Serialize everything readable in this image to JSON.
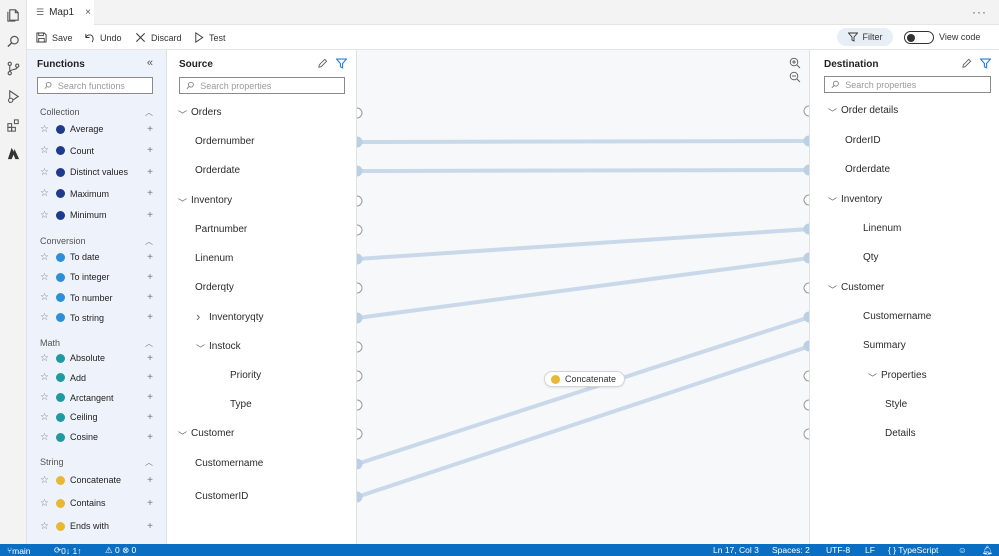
{
  "tab": {
    "title": "Map1",
    "close": "×"
  },
  "more": "···",
  "toolbar": {
    "save": "Save",
    "undo": "Undo",
    "discard": "Discard",
    "test": "Test",
    "filter": "Filter",
    "view_code": "View code",
    "view_code_enabled": false
  },
  "functions": {
    "title": "Functions",
    "search_placeholder": "Search functions",
    "categories": [
      {
        "name": "Collection",
        "items": [
          {
            "label": "Average",
            "color": "#1e3a8a"
          },
          {
            "label": "Count",
            "color": "#1e3a8a"
          },
          {
            "label": "Distinct values",
            "color": "#1e3a8a"
          },
          {
            "label": "Maximum",
            "color": "#1e3a8a"
          },
          {
            "label": "Minimum",
            "color": "#1e3a8a"
          }
        ]
      },
      {
        "name": "Conversion",
        "items": [
          {
            "label": "To date",
            "color": "#2b8fd9"
          },
          {
            "label": "To integer",
            "color": "#2b8fd9"
          },
          {
            "label": "To number",
            "color": "#2b8fd9"
          },
          {
            "label": "To string",
            "color": "#2b8fd9"
          }
        ]
      },
      {
        "name": "Math",
        "items": [
          {
            "label": "Absolute",
            "color": "#1e9aa0"
          },
          {
            "label": "Add",
            "color": "#1e9aa0"
          },
          {
            "label": "Arctangent",
            "color": "#1e9aa0"
          },
          {
            "label": "Ceiling",
            "color": "#1e9aa0"
          },
          {
            "label": "Cosine",
            "color": "#1e9aa0"
          }
        ]
      },
      {
        "name": "String",
        "items": [
          {
            "label": "Concatenate",
            "color": "#e8b733"
          },
          {
            "label": "Contains",
            "color": "#e8b733"
          },
          {
            "label": "Ends with",
            "color": "#e8b733"
          }
        ]
      }
    ]
  },
  "source": {
    "title": "Source",
    "search_placeholder": "Search properties",
    "nodes": [
      {
        "label": "Orders",
        "expander": "expanded"
      },
      {
        "label": "Ordernumber"
      },
      {
        "label": "Orderdate"
      },
      {
        "label": "Inventory",
        "expander": "expanded"
      },
      {
        "label": "Partnumber"
      },
      {
        "label": "Linenum"
      },
      {
        "label": "Orderqty"
      },
      {
        "label": "Inventoryqty",
        "expander": "collapsed"
      },
      {
        "label": "Instock",
        "expander": "expanded"
      },
      {
        "label": "Priority"
      },
      {
        "label": "Type"
      },
      {
        "label": "Customer",
        "expander": "expanded"
      },
      {
        "label": "Customername"
      },
      {
        "label": "CustomerID"
      }
    ]
  },
  "canvas": {
    "function_node": "Concatenate",
    "function_color": "#e8b733",
    "line_color": "#c9d9ea",
    "connected_color": "#b9d0e6"
  },
  "destination": {
    "title": "Destination",
    "search_placeholder": "Search properties",
    "nodes": [
      {
        "label": "Order details",
        "expander": "expanded"
      },
      {
        "label": "OrderID"
      },
      {
        "label": "Orderdate"
      },
      {
        "label": "Inventory",
        "expander": "expanded"
      },
      {
        "label": "Linenum"
      },
      {
        "label": "Qty"
      },
      {
        "label": "Customer",
        "expander": "expanded"
      },
      {
        "label": "Customername"
      },
      {
        "label": "Summary"
      },
      {
        "label": "Properties",
        "expander": "expanded"
      },
      {
        "label": "Style"
      },
      {
        "label": "Details"
      }
    ]
  },
  "mappings": [
    {
      "from": "Ordernumber",
      "to": "OrderID"
    },
    {
      "from": "Orderdate",
      "to": "Orderdate"
    },
    {
      "from": "Linenum",
      "to": "Linenum"
    },
    {
      "from": "Inventoryqty",
      "to": "Qty"
    },
    {
      "from": "Customername",
      "to": "Customername"
    },
    {
      "from": "CustomerID",
      "to": "Summary"
    }
  ],
  "status": {
    "branch": "main",
    "sync": "0↓ 1↑",
    "problems": "⚠ 0 ⊗ 0",
    "position": "Ln 17, Col 3",
    "spaces": "Spaces: 2",
    "encoding": "UTF-8",
    "eol": "LF",
    "language": "{ } TypeScript"
  }
}
